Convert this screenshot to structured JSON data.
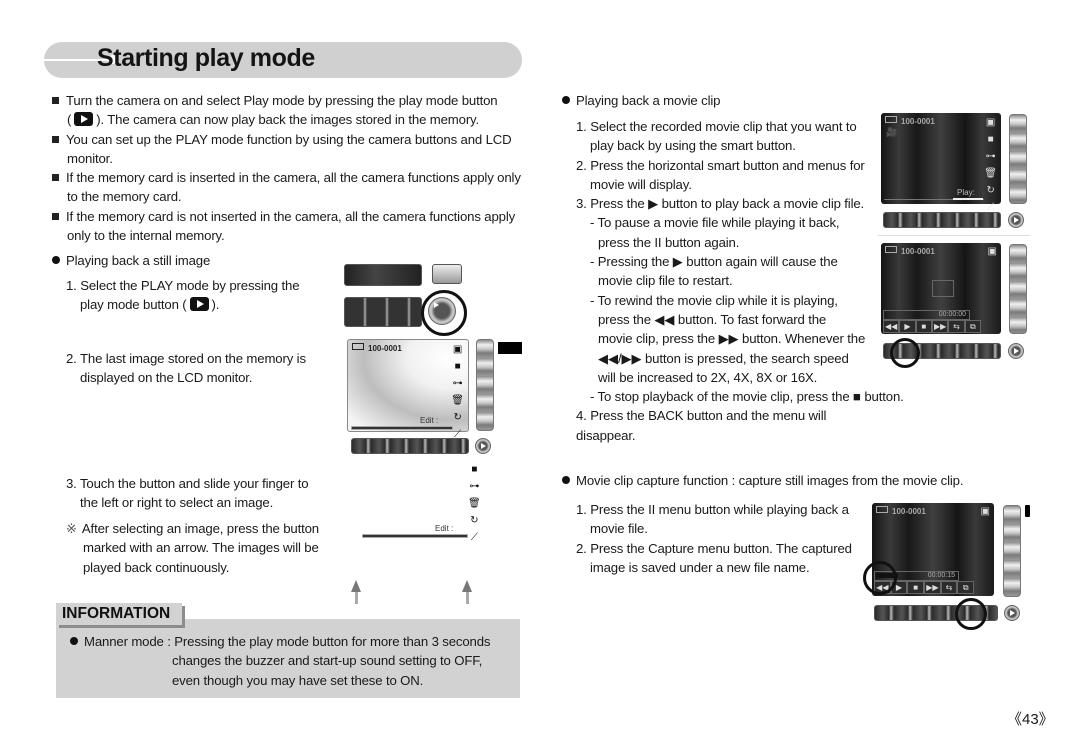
{
  "page": {
    "title": "Starting play mode",
    "page_number": "《43》"
  },
  "left": {
    "intro_bullets": [
      {
        "line1": "Turn the camera on and select Play mode by pressing the play mode button",
        "line2_pre": "(",
        "line2_post": "). The camera can now play back the images stored in the memory."
      },
      {
        "line1": "You can set up the PLAY mode function by using the camera buttons and LCD",
        "line2": "monitor."
      },
      {
        "line1": "If the memory card is inserted in the camera, all the camera functions apply only",
        "line2": "to the memory card."
      },
      {
        "line1": "If the memory card is not inserted in the camera, all the camera functions apply",
        "line2": "only to the internal memory."
      }
    ],
    "still_heading": "Playing back a still image",
    "still_steps": [
      {
        "line1": "1. Select the PLAY mode by pressing the",
        "line2_pre": "play mode button (",
        "line2_post": ")."
      },
      {
        "line1": "2. The last image stored on the memory is",
        "line2": "displayed on the LCD monitor."
      },
      {
        "line1": "3. Touch the button and slide your finger to",
        "line2": "the left or right to select an image."
      }
    ],
    "note": {
      "mark": "※",
      "line1": "After selecting an image, press the button",
      "line2": "marked  with an arrow. The images will be",
      "line3": "played back continuously."
    },
    "camera_still": {
      "file_label": "100-0001",
      "edit_label": "Edit :",
      "side_icons": [
        "play-mode-icon",
        "slideshow-icon",
        "protect-key-icon",
        "delete-icon",
        "rotate-icon",
        "settings-wrench-icon"
      ]
    }
  },
  "information": {
    "heading": "INFORMATION",
    "term": "Manner mode :",
    "line1": "Pressing the play mode button for more than 3 seconds",
    "line2": "changes the buzzer and start-up sound setting to OFF,",
    "line3": "even though you may have set these to ON."
  },
  "right": {
    "movie_heading": "Playing back a movie clip",
    "movie_steps": [
      "1. Select the recorded movie clip that you want to",
      "play back by using the smart button.",
      "2. Press the horizontal smart button and menus for",
      "movie will display.",
      "3. Press the ▶ button to play back a movie clip file.",
      "- To pause a movie file while playing it back,",
      "press the II button again.",
      "- Pressing the ▶ button again will cause the",
      "movie clip file to restart.",
      "- To rewind the movie clip while it is playing,",
      "press the ◀◀ button. To fast forward the",
      "movie clip, press the ▶▶ button. Whenever the",
      "◀◀/▶▶ button is pressed, the search speed",
      "will be increased to 2X, 4X, 8X or 16X.",
      "- To stop playback of the movie clip, press the ■ button.",
      "4. Press the BACK button and the menu will disappear."
    ],
    "capture_heading": "Movie clip capture function : capture still images from the movie clip.",
    "capture_steps": [
      "1. Press the II menu button while playing back a",
      "movie file.",
      "2. Press the Capture menu button. The captured",
      "image is saved under a new file name."
    ],
    "camera_movie_1": {
      "file_label": "100-0001",
      "play_label": "Play:"
    },
    "camera_movie_2": {
      "file_label": "100-0001",
      "time": "00:00:00",
      "controls": [
        "◀◀",
        "▶",
        "■",
        "▶▶",
        "⇆",
        "⧉"
      ]
    },
    "camera_movie_3": {
      "file_label": "100-0001",
      "time": "00:00:15",
      "controls": [
        "◀◀",
        "▶",
        "■",
        "▶▶",
        "⇆",
        "⧉"
      ]
    }
  }
}
